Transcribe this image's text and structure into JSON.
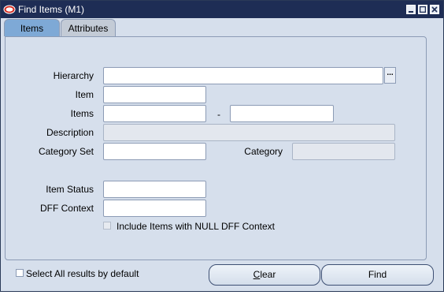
{
  "window": {
    "title": "Find Items (M1)"
  },
  "tabs": [
    {
      "label": "Items",
      "active": true
    },
    {
      "label": "Attributes",
      "active": false
    }
  ],
  "form": {
    "hierarchy_label": "Hierarchy",
    "item_label": "Item",
    "items_label": "Items",
    "range_separator": "-",
    "description_label": "Description",
    "category_set_label": "Category Set",
    "category_label": "Category",
    "item_status_label": "Item Status",
    "dff_context_label": "DFF Context",
    "include_null_dff_label": "Include Items with NULL DFF Context",
    "lov_button_glyph": "..."
  },
  "footer": {
    "select_all_label": "Select All results by default",
    "clear_first": "C",
    "clear_rest": "lear",
    "find_label": "Find"
  },
  "colors": {
    "title_bar": "#1e2d55",
    "form_background": "#d6dfec",
    "active_tab": "#7ea9d6"
  }
}
